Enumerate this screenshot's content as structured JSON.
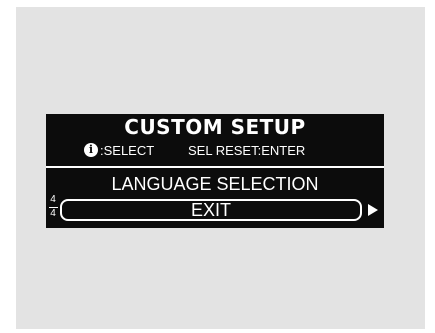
{
  "screen": {
    "title": "CUSTOM SETUP",
    "hint_icon": "info-icon",
    "hint_icon_glyph": "i",
    "hint_select": ":SELECT",
    "hint_reset": "SEL RESET:ENTER"
  },
  "menu": {
    "items": [
      {
        "label": "LANGUAGE SELECTION",
        "selected": false
      },
      {
        "label": "EXIT",
        "selected": true
      }
    ],
    "page_current": "4",
    "page_total": "4",
    "next_icon": "arrow-right-icon"
  },
  "colors": {
    "display_background": "#0c0c0c",
    "display_text": "#ffffff",
    "backdrop": "#e3e3e3"
  }
}
